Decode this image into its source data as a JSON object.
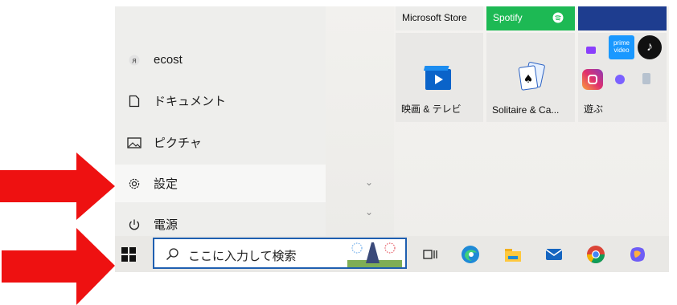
{
  "start_menu": {
    "user": {
      "name": "ecost",
      "icon": "user-icon"
    },
    "items": [
      {
        "label": "ドキュメント",
        "icon": "document-icon"
      },
      {
        "label": "ピクチャ",
        "icon": "pictures-icon"
      },
      {
        "label": "設定",
        "icon": "gear-icon"
      },
      {
        "label": "電源",
        "icon": "power-icon"
      }
    ]
  },
  "tiles": {
    "microsoft_store": "Microsoft Store",
    "spotify": "Spotify",
    "movies": "映画 & テレビ",
    "solitaire": "Solitaire & Ca...",
    "play": "遊ぶ",
    "prime_video": "prime video"
  },
  "taskbar": {
    "search_placeholder": "ここに入力して検索",
    "apps": [
      "task-view-icon",
      "edge-icon",
      "file-explorer-icon",
      "mail-icon",
      "chrome-icon",
      "copilot-icon"
    ]
  },
  "colors": {
    "spotify_green": "#1db954",
    "store_blue": "#1e3d8f",
    "search_border": "#1f5fb0",
    "arrow_red": "#ee1111"
  }
}
